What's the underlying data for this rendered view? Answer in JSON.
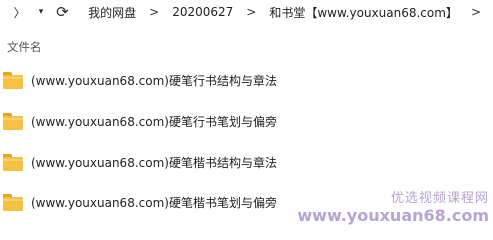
{
  "toolbar": {
    "forward_glyph": "〉",
    "dropdown_glyph": "▾",
    "refresh_glyph": "⟳"
  },
  "breadcrumb": {
    "items": [
      "我的网盘",
      "20200627",
      "和书堂【www.youxuan68.com】"
    ],
    "separator": ">"
  },
  "list_header": {
    "name_label": "文件名"
  },
  "files": [
    {
      "name": "(www.youxuan68.com)硬笔行书结构与章法",
      "type": "folder"
    },
    {
      "name": "(www.youxuan68.com)硬笔行书笔划与偏旁",
      "type": "folder"
    },
    {
      "name": "(www.youxuan68.com)硬笔楷书结构与章法",
      "type": "folder"
    },
    {
      "name": "(www.youxuan68.com)硬笔楷书笔划与偏旁",
      "type": "folder"
    }
  ],
  "watermark": {
    "line1": "优选视频课程网",
    "line2": "www.youxuan68.com"
  },
  "colors": {
    "folder": "#f6c142",
    "folder_tab": "#e8a317",
    "watermark": "#b8a3d4"
  },
  "icons": {
    "forward": "chevron-right-icon",
    "dropdown": "caret-down-icon",
    "refresh": "refresh-icon",
    "folder": "folder-icon"
  }
}
